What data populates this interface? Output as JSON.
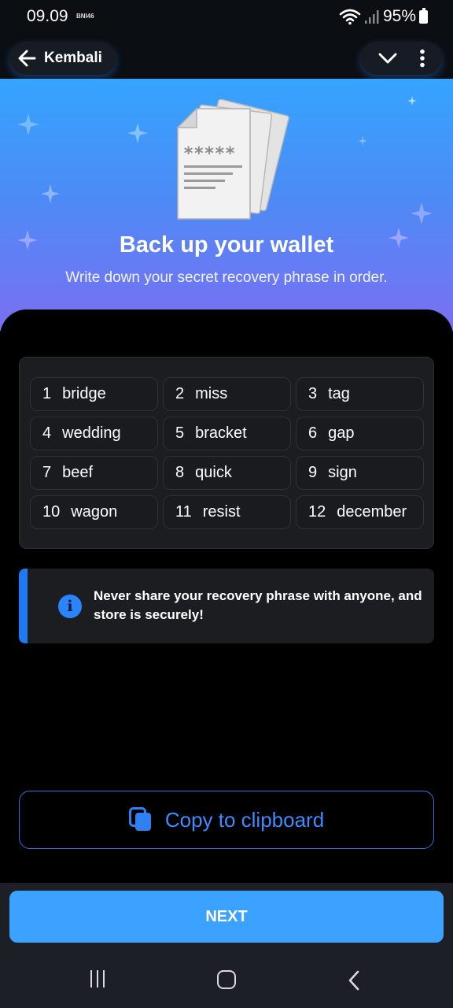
{
  "status_bar": {
    "time": "09.09",
    "carrier": "BNI46",
    "battery": "95%"
  },
  "nav": {
    "back_label": "Kembali"
  },
  "hero": {
    "title": "Back up your wallet",
    "subtitle": "Write down your secret recovery phrase in order.",
    "document_masked_text": "*****"
  },
  "phrase": {
    "words": [
      {
        "num": "1",
        "word": "bridge"
      },
      {
        "num": "2",
        "word": "miss"
      },
      {
        "num": "3",
        "word": "tag"
      },
      {
        "num": "4",
        "word": "wedding"
      },
      {
        "num": "5",
        "word": "bracket"
      },
      {
        "num": "6",
        "word": "gap"
      },
      {
        "num": "7",
        "word": "beef"
      },
      {
        "num": "8",
        "word": "quick"
      },
      {
        "num": "9",
        "word": "sign"
      },
      {
        "num": "10",
        "word": "wagon"
      },
      {
        "num": "11",
        "word": "resist"
      },
      {
        "num": "12",
        "word": "december"
      }
    ]
  },
  "warning": {
    "icon": "info-icon",
    "icon_glyph": "i",
    "text": "Never share your recovery phrase with anyone, and store is securely!"
  },
  "copy": {
    "label": "Copy to clipboard",
    "icon": "copy-icon"
  },
  "next": {
    "label": "NEXT"
  },
  "colors": {
    "accent": "#3ba3ff",
    "warning_bar": "#1d7af3",
    "copy_text": "#3a8cff"
  }
}
